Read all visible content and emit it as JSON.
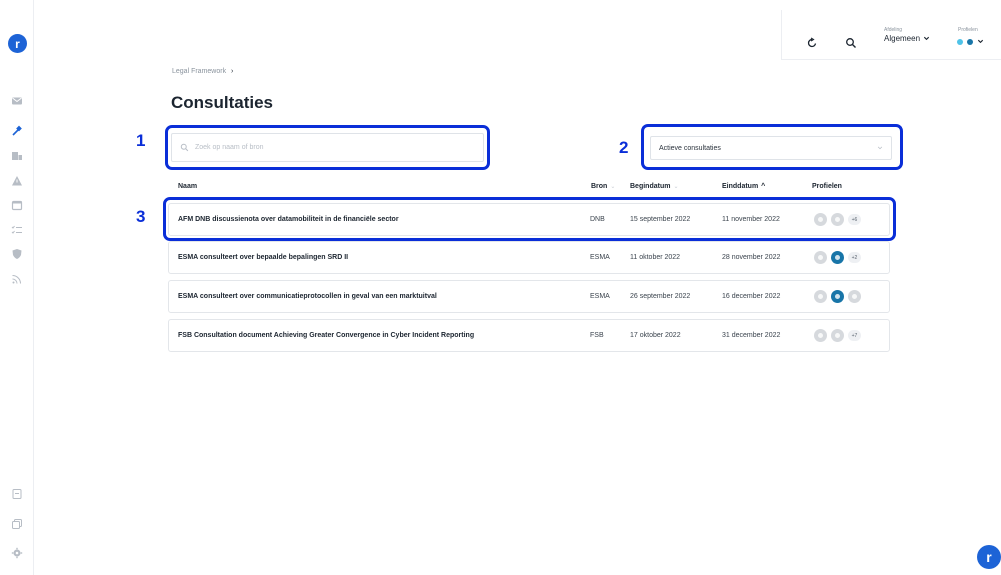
{
  "sidebar": {
    "logo": "r",
    "icons": [
      "mail-icon",
      "gavel-icon",
      "document-stack-icon",
      "warning-icon",
      "calendar-icon",
      "checklist-icon",
      "shield-icon",
      "rss-icon",
      "list-icon",
      "copy-icon",
      "settings-icon"
    ]
  },
  "topbar": {
    "department_label": "Afdeling",
    "department_value": "Algemeen",
    "profiles_label": "Profielen"
  },
  "breadcrumb": {
    "item": "Legal Framework",
    "separator": "›"
  },
  "page": {
    "title": "Consultaties"
  },
  "search": {
    "placeholder": "Zoek op naam of bron"
  },
  "filter": {
    "selected": "Actieve consultaties"
  },
  "annotations": {
    "one": "1",
    "two": "2",
    "three": "3"
  },
  "table": {
    "headers": {
      "name": "Naam",
      "source": "Bron",
      "start": "Begindatum",
      "end": "Einddatum",
      "profiles": "Profielen"
    },
    "sort_indicator": "^",
    "rows": [
      {
        "name": "AFM DNB discussienota over datamobiliteit in de financiële sector",
        "source": "DNB",
        "start": "15 september 2022",
        "end": "11 november 2022",
        "more": "+6"
      },
      {
        "name": "ESMA consulteert over bepaalde bepalingen SRD II",
        "source": "ESMA",
        "start": "11 oktober 2022",
        "end": "28 november 2022",
        "more": "+2"
      },
      {
        "name": "ESMA consulteert over communicatieprotocollen in geval van een marktuitval",
        "source": "ESMA",
        "start": "26 september 2022",
        "end": "16 december 2022",
        "more": ""
      },
      {
        "name": "FSB Consultation document Achieving Greater Convergence in Cyber Incident Reporting",
        "source": "FSB",
        "start": "17 oktober 2022",
        "end": "31 december 2022",
        "more": "+7"
      }
    ]
  },
  "colors": {
    "accent": "#1d63d6",
    "highlight": "#0a2ed8",
    "profile_blue": "#1875a8"
  }
}
